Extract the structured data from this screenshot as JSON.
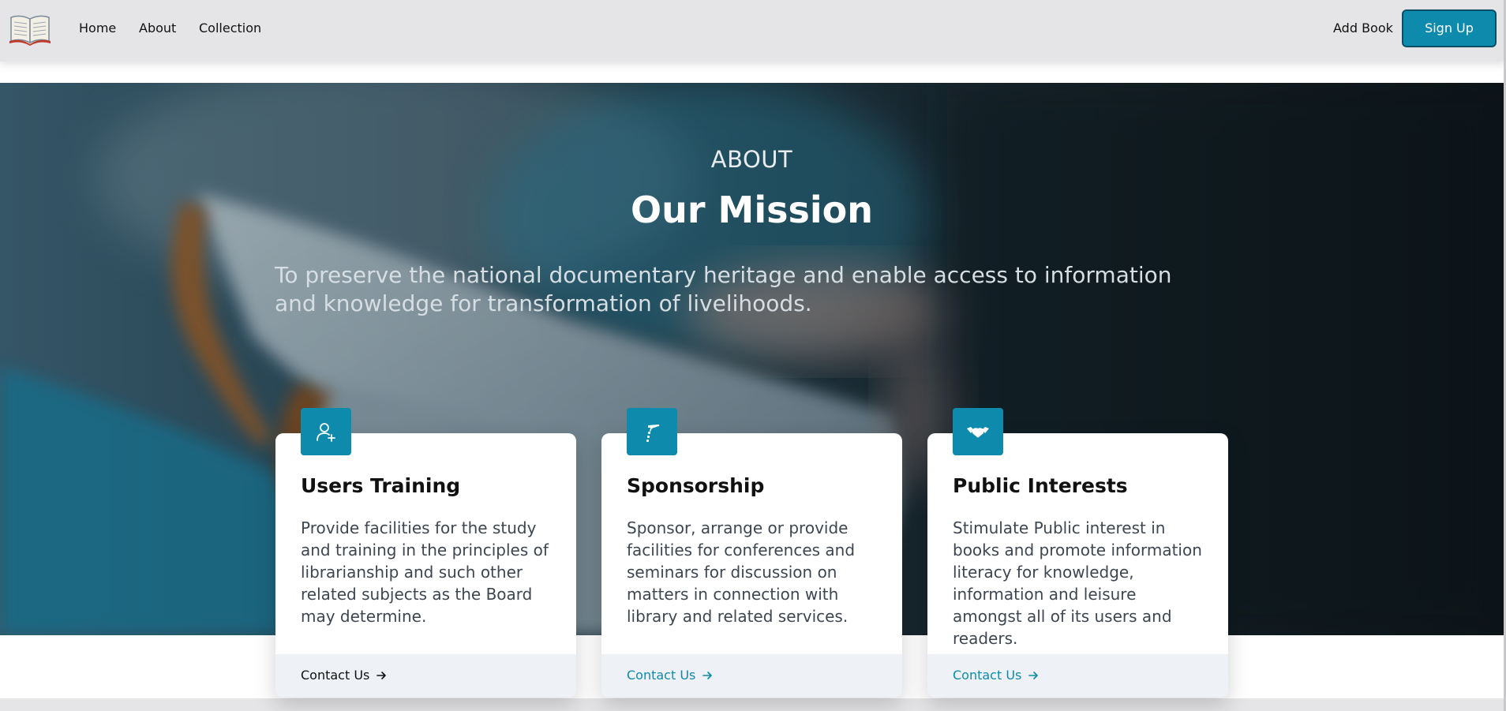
{
  "nav": {
    "logo_icon": "open-book-icon",
    "links": [
      "Home",
      "About",
      "Collection"
    ],
    "add_book": "Add Book",
    "sign_up": "Sign Up"
  },
  "hero": {
    "eyebrow": "ABOUT",
    "title": "Our Mission",
    "text": "To preserve the national documentary heritage and enable access to information and knowledge for transformation of livelihoods."
  },
  "cards": [
    {
      "icon": "user-plus-icon",
      "title": "Users Training",
      "text": "Provide facilities for the study and training in the principles of librarianship and such other related subjects as the Board may determine.",
      "link": "Contact Us"
    },
    {
      "icon": "sponsor-hand-icon",
      "title": "Sponsorship",
      "text": "Sponsor, arrange or provide facilities for conferences and seminars for discussion on matters in connection with library and related services.",
      "link": "Contact Us"
    },
    {
      "icon": "handshake-icon",
      "title": "Public Interests",
      "text": "Stimulate Public interest in books and promote information literacy for knowledge, information and leisure amongst all of its users and readers.",
      "link": "Contact Us"
    }
  ],
  "colors": {
    "accent": "#0e8aad",
    "navbar_bg": "#e5e5e7",
    "card_footer_bg": "#eef2f6"
  }
}
